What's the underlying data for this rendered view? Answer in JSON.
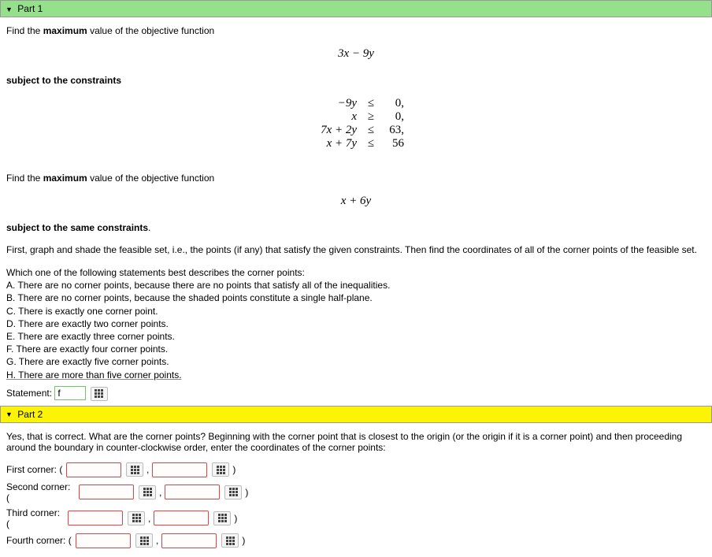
{
  "part1": {
    "header": "Part 1",
    "intro1a": "Find the ",
    "intro1b": "maximum",
    "intro1c": " value of the objective function",
    "objective1": "3x − 9y",
    "subject_label_a": "subject to the constraints",
    "constraints": [
      {
        "lhs": "−9y",
        "rel": "≤",
        "rhs": "0,"
      },
      {
        "lhs": "x",
        "rel": "≥",
        "rhs": "0,"
      },
      {
        "lhs": "7x + 2y",
        "rel": "≤",
        "rhs": "63,"
      },
      {
        "lhs": "x + 7y",
        "rel": "≤",
        "rhs": "56"
      }
    ],
    "intro2a": "Find the ",
    "intro2b": "maximum",
    "intro2c": " value of the objective function",
    "objective2": "x + 6y",
    "subject_label_b": "subject to the same constraints",
    "instructions": "First, graph and shade the feasible set, i.e., the points (if any) that satisfy the given constraints. Then find the coordinates of all of the corner points of the feasible set.",
    "question": "Which one of the following statements best describes the corner points:",
    "options": {
      "A": "A. There are no corner points, because there are no points that satisfy all of the inequalities.",
      "B": "B. There are no corner points, because the shaded points constitute a single half-plane.",
      "C": "C. There is exactly one corner point.",
      "D": "D. There are exactly two corner points.",
      "E": "E. There are exactly three corner points.",
      "F": "F. There are exactly four corner points.",
      "G": "G. There are exactly five corner points.",
      "H": "H. There are more than five corner points."
    },
    "statement_label": "Statement:",
    "statement_value": "f"
  },
  "part2": {
    "header": "Part 2",
    "feedback": "Yes, that is correct. What are the corner points? Beginning with the corner point that is closest to the origin (or the origin if it is a corner point) and then proceeding around the boundary in counter-clockwise order, enter the coordinates of the corner points:",
    "corners": [
      {
        "label": "First corner: ("
      },
      {
        "label": "Second corner: ("
      },
      {
        "label": "Third corner: ("
      },
      {
        "label": "Fourth corner: ("
      }
    ],
    "comma": ",",
    "close": ")"
  }
}
